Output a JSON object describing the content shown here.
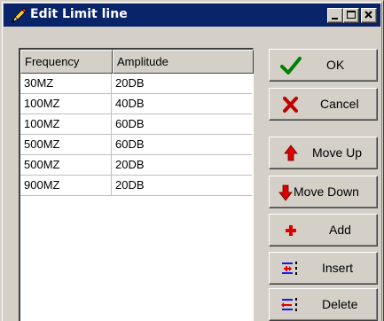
{
  "window": {
    "title": "Edit Limit line",
    "colors": {
      "face": "#d4d0c8",
      "titlebar": "#0a246a",
      "accent_red": "#e00000",
      "accent_green": "#008000"
    }
  },
  "table": {
    "columns": [
      "Frequency",
      "Amplitude"
    ],
    "rows": [
      {
        "frequency": "30MZ",
        "amplitude": "20DB"
      },
      {
        "frequency": "100MZ",
        "amplitude": "40DB"
      },
      {
        "frequency": "100MZ",
        "amplitude": "60DB"
      },
      {
        "frequency": "500MZ",
        "amplitude": "60DB"
      },
      {
        "frequency": "500MZ",
        "amplitude": "20DB"
      },
      {
        "frequency": "900MZ",
        "amplitude": "20DB"
      }
    ]
  },
  "buttons": {
    "ok": "OK",
    "cancel": "Cancel",
    "move_up": "Move Up",
    "move_down": "Move Down",
    "add": "Add",
    "insert": "Insert",
    "delete": "Delete"
  },
  "icons": {
    "title": "pencil-icon",
    "minimize": "minimize-icon",
    "maximize": "maximize-icon",
    "close": "close-icon",
    "ok": "checkmark-icon",
    "cancel": "x-mark-icon",
    "move_up": "arrow-up-icon",
    "move_down": "arrow-down-icon",
    "add": "plus-icon",
    "insert": "insert-row-icon",
    "delete": "delete-row-icon"
  }
}
